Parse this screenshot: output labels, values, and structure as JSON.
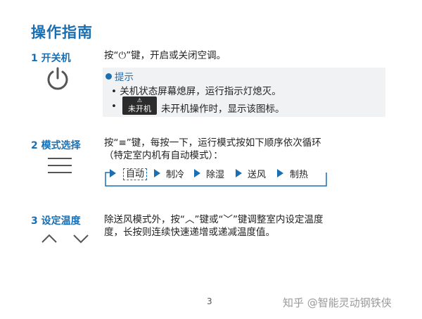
{
  "title": "操作指南",
  "sections": [
    {
      "label": "1 开关机",
      "icon": "power-icon",
      "text": "按“⏻”键，开启或关闭空调。",
      "tip": {
        "head": "提示",
        "bullets": [
          "关机状态屏幕熄屏，运行指示灯熄灭。",
          "未开机操作时，显示该图标。"
        ],
        "badge_symbol": "⚠",
        "badge_text": "未开机"
      }
    },
    {
      "label": "2 模式选择",
      "icon": "menu-icon",
      "text_line1": "按“≡”键，每按一下，运行模式按如下顺序依次循环",
      "text_line2": "（特定室内机有自动模式）：",
      "modes": [
        "自动",
        "制冷",
        "除湿",
        "送风",
        "制热"
      ]
    },
    {
      "label": "3 设定温度",
      "icon": "up-down-chevron-icon",
      "text_line1": "除送风模式外，按“︿”键或“﹀”键调整室内设定温度",
      "text_line2": "度，长按则连续快速递增或递减温度值。"
    }
  ],
  "page_number": "3",
  "watermark": "知乎 @智能灵动钢铁侠",
  "colors": {
    "accent": "#1a6fb3",
    "tip_bg": "#f1f2f4",
    "badge_bg": "#2b2b2b"
  }
}
